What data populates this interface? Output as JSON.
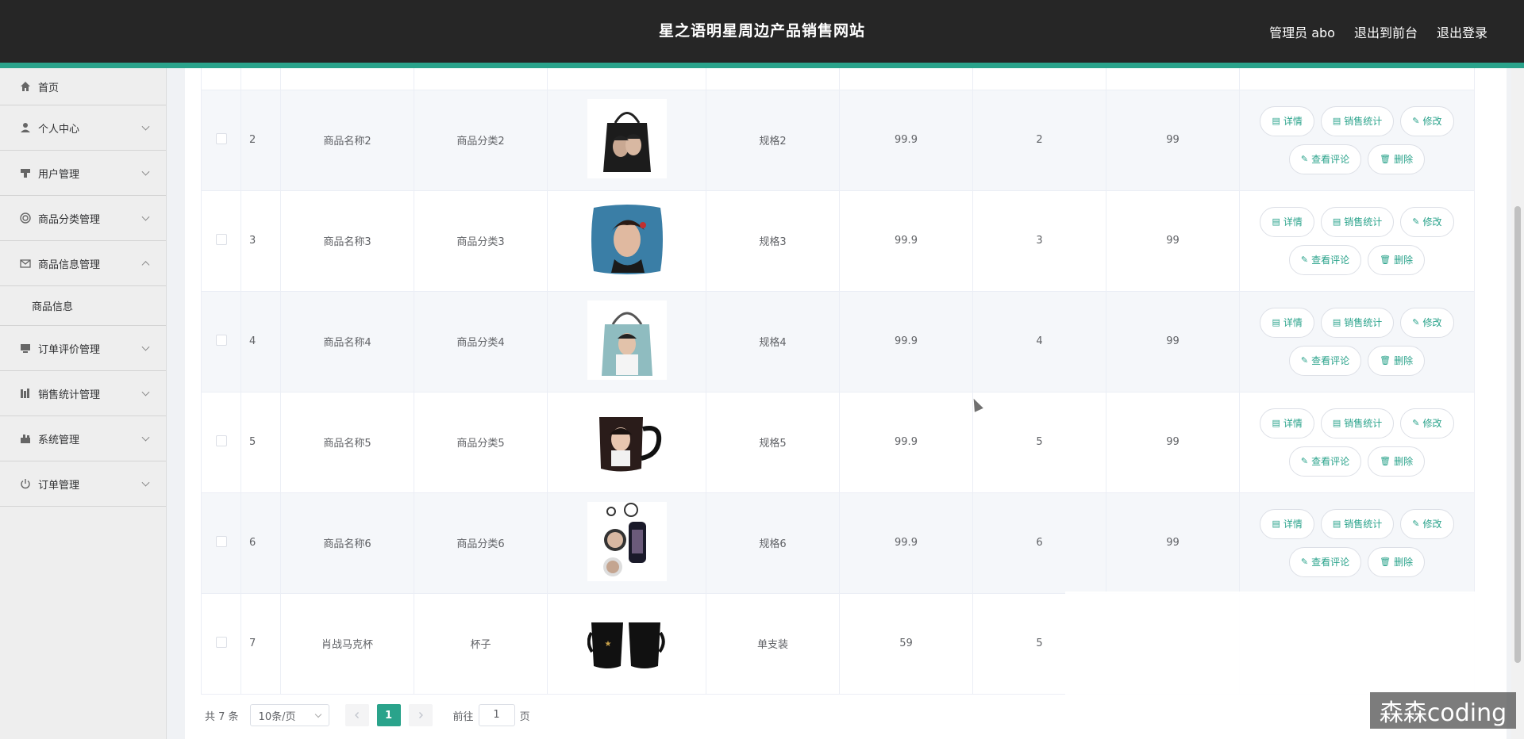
{
  "header": {
    "title": "星之语明星周边产品销售网站",
    "admin": "管理员 abo",
    "back_to_front": "退出到前台",
    "logout": "退出登录"
  },
  "sidebar": {
    "items": [
      {
        "label": "首页",
        "icon": "home-icon"
      },
      {
        "label": "个人中心",
        "icon": "user-icon"
      },
      {
        "label": "用户管理",
        "icon": "users-icon"
      },
      {
        "label": "商品分类管理",
        "icon": "category-icon"
      },
      {
        "label": "商品信息管理",
        "icon": "mail-icon",
        "expanded": true,
        "children": [
          "商品信息"
        ]
      },
      {
        "label": "订单评价管理",
        "icon": "monitor-icon"
      },
      {
        "label": "销售统计管理",
        "icon": "chart-icon"
      },
      {
        "label": "系统管理",
        "icon": "system-icon"
      },
      {
        "label": "订单管理",
        "icon": "power-icon"
      }
    ]
  },
  "actions": {
    "detail": "详情",
    "stats": "销售统计",
    "edit": "修改",
    "comments": "查看评论",
    "delete": "删除"
  },
  "rows": [
    {
      "idx": "2",
      "name": "商品名称2",
      "category": "商品分类2",
      "image": "tote-bag",
      "spec": "规格2",
      "price": "99.9",
      "count": "2",
      "stock": "99"
    },
    {
      "idx": "3",
      "name": "商品名称3",
      "category": "商品分类3",
      "image": "pillow",
      "spec": "规格3",
      "price": "99.9",
      "count": "3",
      "stock": "99"
    },
    {
      "idx": "4",
      "name": "商品名称4",
      "category": "商品分类4",
      "image": "tote-bag-2",
      "spec": "规格4",
      "price": "99.9",
      "count": "4",
      "stock": "99"
    },
    {
      "idx": "5",
      "name": "商品名称5",
      "category": "商品分类5",
      "image": "mug",
      "spec": "规格5",
      "price": "99.9",
      "count": "5",
      "stock": "99"
    },
    {
      "idx": "6",
      "name": "商品名称6",
      "category": "商品分类6",
      "image": "keychain",
      "spec": "规格6",
      "price": "99.9",
      "count": "6",
      "stock": "99"
    },
    {
      "idx": "7",
      "name": "肖战马克杯",
      "category": "杯子",
      "image": "black-mugs",
      "spec": "单支装",
      "price": "59",
      "count": "5",
      "stock": ""
    }
  ],
  "pagination": {
    "total": "共 7 条",
    "page_size": "10条/页",
    "current": "1",
    "goto_label": "前往",
    "goto_value": "1",
    "page_unit": "页"
  },
  "watermark": "森森coding",
  "colors": {
    "accent": "#2aa38b",
    "header": "#262626"
  }
}
